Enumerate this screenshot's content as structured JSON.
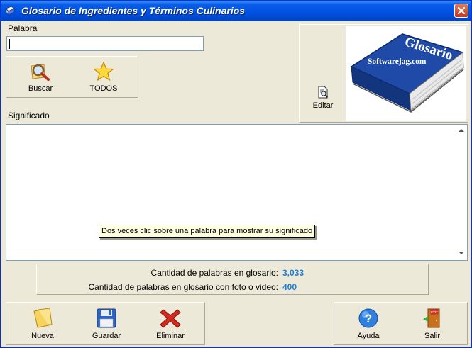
{
  "window": {
    "title": "Glosario de Ingredientes y Términos Culinarios"
  },
  "search": {
    "label": "Palabra",
    "value": ""
  },
  "buttons": {
    "buscar": "Buscar",
    "todos": "TODOS",
    "editar": "Editar",
    "nueva": "Nueva",
    "guardar": "Guardar",
    "eliminar": "Eliminar",
    "ayuda": "Ayuda",
    "salir": "Salir"
  },
  "meaning": {
    "label": "Significado",
    "tooltip": "Dos veces clic sobre una palabra para mostrar su significado"
  },
  "stats": {
    "total_label": "Cantidad de palabras en glosario:",
    "total_value": "3,033",
    "media_label": "Cantidad de palabras en glosario con foto o video:",
    "media_value": "400"
  },
  "logo": {
    "book_title": "Glosario",
    "site": "Softwarejag.com"
  },
  "colors": {
    "title_bar": "#0054e3",
    "stat_value": "#1e7ddc",
    "book_blue": "#1f4aa8",
    "close_button": "#c0391d"
  }
}
